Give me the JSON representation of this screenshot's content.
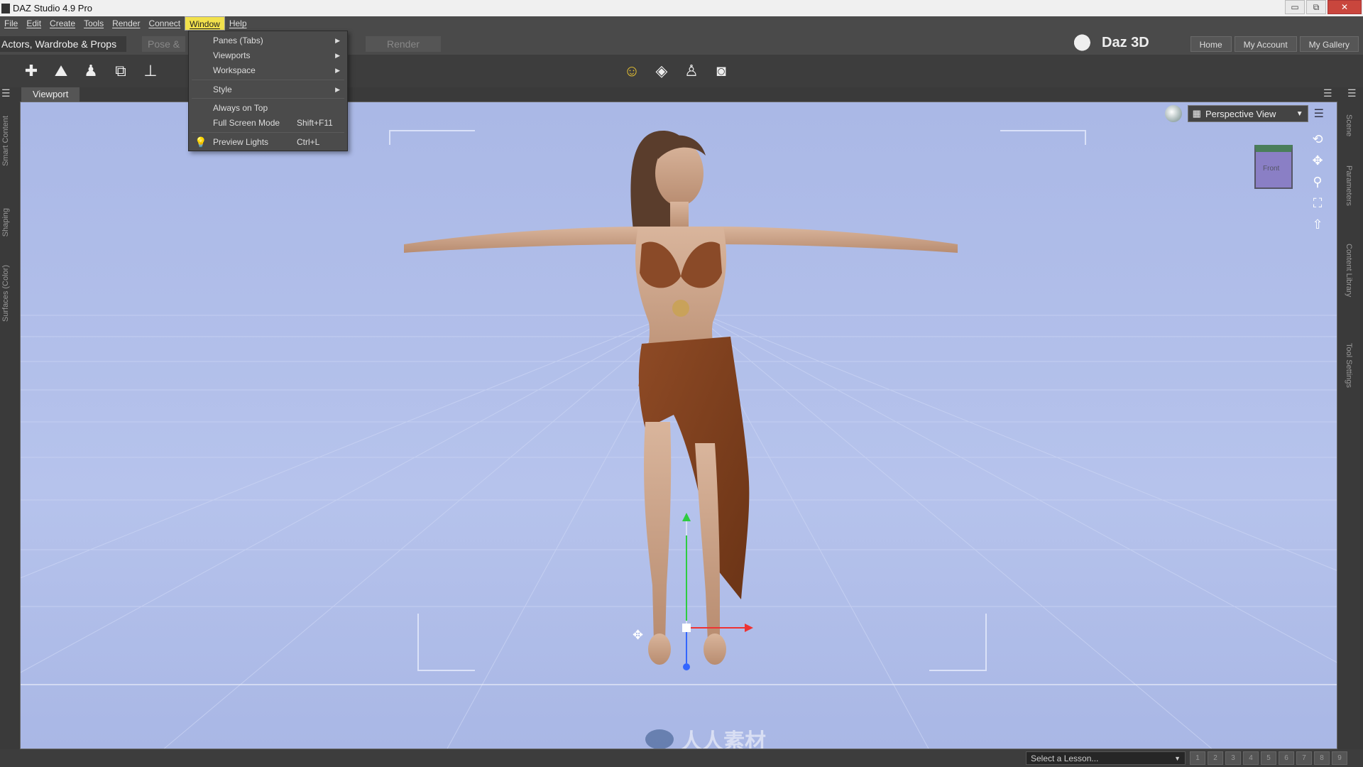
{
  "window": {
    "title": "DAZ Studio 4.9 Pro",
    "controls": {
      "minimize": "▭",
      "maximize": "⧉",
      "close": "✕"
    }
  },
  "menubar": {
    "items": [
      "File",
      "Edit",
      "Create",
      "Tools",
      "Render",
      "Connect",
      "Window",
      "Help"
    ],
    "active": "Window"
  },
  "window_menu": {
    "items": [
      {
        "label": "Panes (Tabs)",
        "submenu": true
      },
      {
        "label": "Viewports",
        "submenu": true
      },
      {
        "label": "Workspace",
        "submenu": true
      },
      {
        "label": "Style",
        "submenu": true
      },
      {
        "label": "Always on Top",
        "submenu": false
      },
      {
        "label": "Full Screen Mode",
        "shortcut": "Shift+F11"
      },
      {
        "label": "Preview Lights",
        "shortcut": "Ctrl+L",
        "icon": "lightbulb-icon"
      }
    ]
  },
  "rooms": {
    "active": "Actors, Wardrobe & Props",
    "pose": "Pose &",
    "render": "Render"
  },
  "brand": {
    "name": "Daz 3D"
  },
  "top_links": [
    "Home",
    "My Account",
    "My Gallery"
  ],
  "toolbar": {
    "left_icons": [
      "add-figure-icon",
      "add-scene-icon",
      "add-people-icon",
      "add-prop-icon",
      "add-object-icon"
    ],
    "center_icons": [
      "pose-tool-icon",
      "diamond-tool-icon",
      "figure-tool-icon",
      "camera-tool-icon"
    ]
  },
  "viewport": {
    "tab_label": "Viewport",
    "view_select": "Perspective View",
    "nav_cube_label": "Front",
    "background_color": "#aebceb"
  },
  "side_panes": {
    "left": [
      "Smart Content",
      "Shaping",
      "Surfaces (Color)"
    ],
    "right": [
      "Scene",
      "Parameters",
      "Content Library",
      "Tool Settings"
    ]
  },
  "statusbar": {
    "lesson_placeholder": "Select a Lesson...",
    "steps": [
      "1",
      "2",
      "3",
      "4",
      "5",
      "6",
      "7",
      "8",
      "9"
    ]
  },
  "watermark": {
    "text": "人人素材"
  }
}
